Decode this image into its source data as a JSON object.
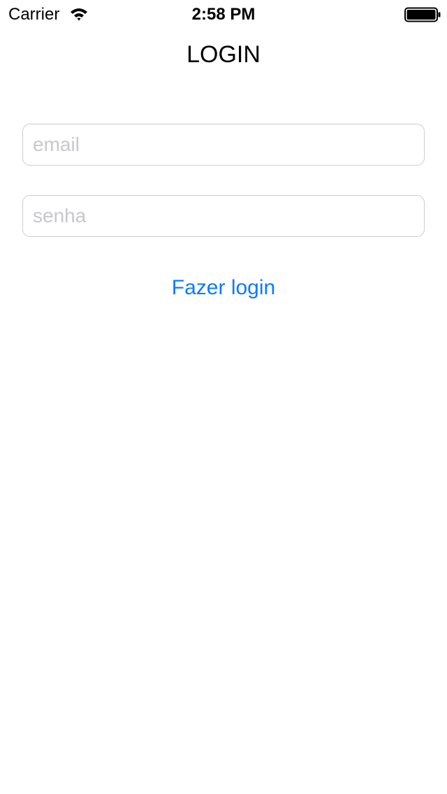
{
  "status_bar": {
    "carrier": "Carrier",
    "time": "2:58 PM",
    "wifi_icon": "wifi-icon",
    "battery_icon": "battery-icon"
  },
  "nav": {
    "title": "LOGIN"
  },
  "form": {
    "email": {
      "value": "",
      "placeholder": "email"
    },
    "password": {
      "value": "",
      "placeholder": "senha"
    },
    "submit_label": "Fazer login"
  },
  "colors": {
    "accent": "#0e7afe",
    "placeholder": "#c7c7cd",
    "field_border": "#cdcdd1",
    "background": "#ffffff"
  }
}
